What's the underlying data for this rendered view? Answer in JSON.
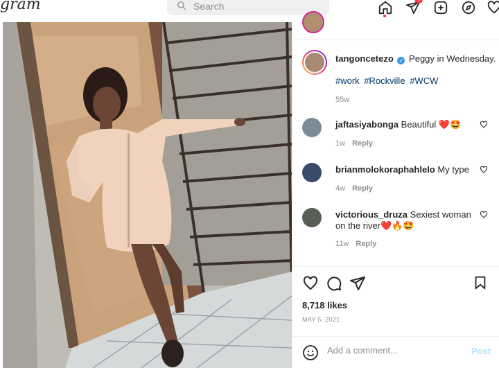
{
  "nav": {
    "logo_text": "gram",
    "search_placeholder": "Search",
    "notification_count": "6"
  },
  "post": {
    "header_username": "",
    "author": "tangoncetezo",
    "caption_text": "Peggy in Wednesday.",
    "hashtags": [
      "#work",
      "#Rockville",
      "#WCW"
    ],
    "caption_time": "55w",
    "comments": [
      {
        "user": "jaftasiyabonga",
        "text": "Beautiful ❤️🤩",
        "time": "1w",
        "reply": "Reply"
      },
      {
        "user": "brianmolokoraphahlelo",
        "text": "My type",
        "time": "4w",
        "reply": "Reply"
      },
      {
        "user": "victorious_druza",
        "text": "Sexiest woman on the river❤️🔥🤩",
        "time": "11w",
        "reply": "Reply"
      }
    ],
    "likes": "8,718 likes",
    "date": "MAY 5, 2021",
    "comment_placeholder": "Add a comment...",
    "post_button": "Post"
  },
  "colors": {
    "link": "#00376b",
    "notification": "#ff3040",
    "verified": "#3897f0",
    "post_button_disabled": "#b2dffc"
  }
}
